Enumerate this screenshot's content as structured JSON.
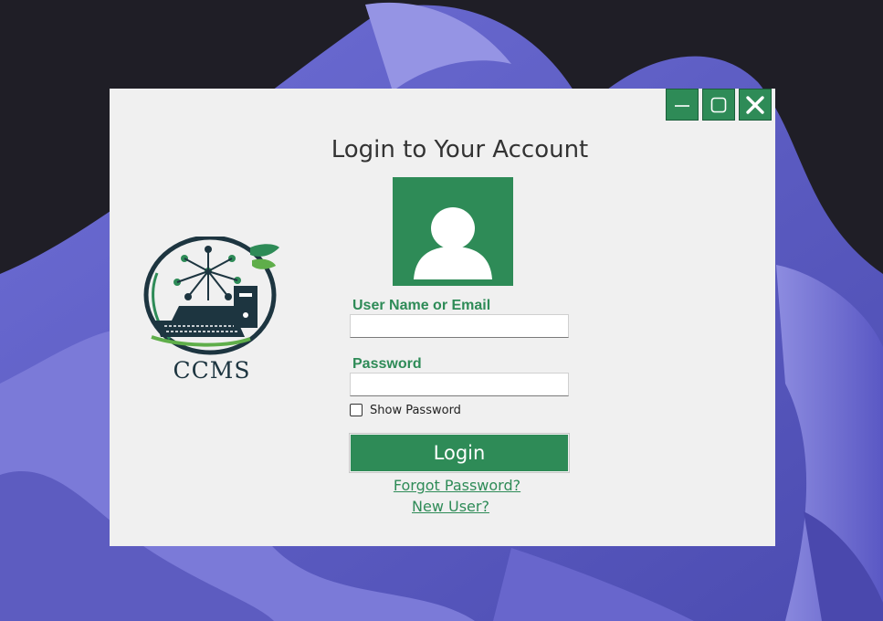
{
  "window": {
    "title": "Login to Your Account",
    "controls": {
      "minimize": "minimize",
      "maximize": "maximize",
      "close": "close"
    }
  },
  "logo": {
    "text": "CCMS"
  },
  "form": {
    "username_label": "User Name or Email",
    "username_value": "",
    "password_label": "Password",
    "password_value": "",
    "show_password_label": "Show Password",
    "show_password_checked": false,
    "login_label": "Login",
    "forgot_link": "Forgot Password?",
    "new_user_link": "New User?"
  },
  "colors": {
    "accent": "#2e8b57",
    "window_bg": "#f0f0f0"
  },
  "icons": [
    "minimize-icon",
    "maximize-icon",
    "close-icon",
    "user-avatar-icon",
    "ccms-logo-icon"
  ]
}
